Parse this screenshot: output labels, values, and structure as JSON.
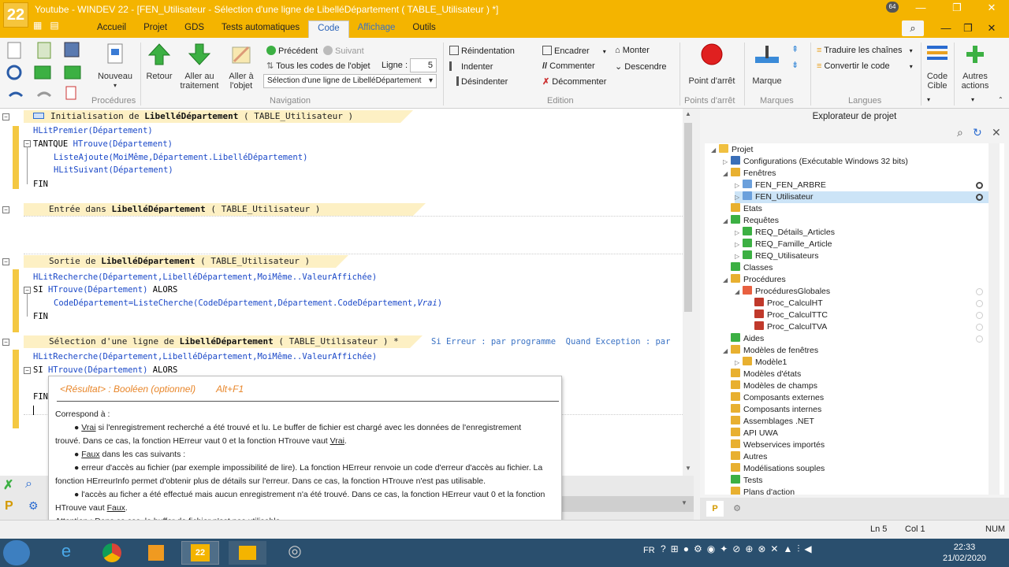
{
  "window": {
    "title": "Youtube - WINDEV 22 - [FEN_Utilisateur - Sélection d'une ligne de LibelléDépartement ( TABLE_Utilisateur ) *]",
    "badge": "64",
    "logo": "22"
  },
  "menu": [
    "Accueil",
    "Projet",
    "GDS",
    "Tests automatiques",
    "Code",
    "Affichage",
    "Outils"
  ],
  "ribbon": {
    "groups": [
      "Procédures",
      "Navigation",
      "Edition",
      "Points d'arrêt",
      "Marques",
      "Langues"
    ],
    "buttons": {
      "nouveau": "Nouveau",
      "retour": "Retour",
      "aller_traitement_1": "Aller au",
      "aller_traitement_2": "traitement",
      "aller_objet_1": "Aller à",
      "aller_objet_2": "l'objet",
      "precedent": "Précédent",
      "suivant": "Suivant",
      "tous_codes": "Tous les codes de l'objet",
      "ligne_label": "Ligne :",
      "ligne_value": "5",
      "selection_combo": "Sélection d'une ligne de LibelléDépartement",
      "reindentation": "Réindentation",
      "indenter": "Indenter",
      "desindenter": "Désindenter",
      "encadrer": "Encadrer",
      "commenter": "Commenter",
      "decommenter": "Décommenter",
      "monter": "Monter",
      "descendre": "Descendre",
      "point_arret": "Point d'arrêt",
      "marque": "Marque",
      "traduire": "Traduire les chaînes",
      "convertir": "Convertir le code",
      "code_cible_1": "Code",
      "code_cible_2": "Cible",
      "autres_1": "Autres",
      "autres_2": "actions"
    }
  },
  "editor": {
    "sections": [
      {
        "prefix": "Initialisation de ",
        "name": "LibelléDépartement",
        "suffix": " ( TABLE_Utilisateur )"
      },
      {
        "prefix": "Entrée dans ",
        "name": "LibelléDépartement",
        "suffix": " ( TABLE_Utilisateur )"
      },
      {
        "prefix": "Sortie de ",
        "name": "LibelléDépartement",
        "suffix": " ( TABLE_Utilisateur )"
      },
      {
        "prefix": "Sélection d'une ligne de ",
        "name": "LibelléDépartement",
        "suffix": " ( TABLE_Utilisateur ) *"
      }
    ],
    "error_info": "Si Erreur : par programme  Quand Exception : par",
    "code": {
      "l1": "HLitPremier(Département)",
      "l2_kw": "TANTQUE ",
      "l2": "HTrouve(Département)",
      "l3": "ListeAjoute(MoiMême,Département.LibelléDépartement)",
      "l4": "HLitSuivant(Département)",
      "fin": "FIN",
      "s3_l1": "HLitRecherche(Département,LibelléDépartement,MoiMême..ValeurAffichée)",
      "s3_l2_kw": "SI ",
      "s3_l2": "HTrouve(Département)",
      "alors": " ALORS",
      "s3_l3a": "CodeDépartement=ListeCherche(CodeDépartement,Département.CodeDépartement,",
      "s3_l3b": "Vrai",
      "s3_l3c": ")",
      "s4_l1": "HLitRecherche(Département,LibelléDépartement,MoiMême..ValeurAffichée)",
      "s4_l2_kw": "SI ",
      "s4_l2": "HTrouve(Département)",
      "s4_fin": "FIN"
    }
  },
  "tooltip": {
    "result": "<Résultat> : Booléen (optionnel)",
    "shortcut": "Alt+F1",
    "intro": "Correspond à :",
    "vrai_word": "Vrai",
    "vrai_text": " si l'enregistrement recherché a été trouvé et lu. Le buffer de fichier est chargé avec les données de l'enregistrement",
    "vrai_text2": "trouvé. Dans ce cas, la fonction HErreur vaut 0 et la fonction HTrouve vaut ",
    "vrai_word2": "Vrai",
    "faux_word": "Faux",
    "faux_text": " dans les cas suivants :",
    "err1": "erreur d'accès au fichier (par exemple impossibilité de lire). La fonction HErreur renvoie un code d'erreur d'accès au fichier. La",
    "err1b": "fonction HErreurInfo permet d'obtenir plus de détails sur l'erreur. Dans ce cas, la fonction HTrouve n'est pas utilisable.",
    "err2": "l'accès au ficher a été effectué mais aucun enregistrement n'a été trouvé. Dans ce cas, la fonction HErreur vaut 0 et la fonction",
    "err2b": "HTrouve vaut ",
    "faux_word2": "Faux",
    "attention": "Attention : Dans ce cas, le buffer de fichier n'est pas utilisable."
  },
  "explorer": {
    "title": "Explorateur de projet",
    "nodes": [
      {
        "label": "Projet",
        "level": 0
      },
      {
        "label": "Configurations (Exécutable Windows 32 bits)",
        "level": 1
      },
      {
        "label": "Fenêtres",
        "level": 1
      },
      {
        "label": "FEN_FEN_ARBRE",
        "level": 2
      },
      {
        "label": "FEN_Utilisateur",
        "level": 2
      },
      {
        "label": "Etats",
        "level": 1
      },
      {
        "label": "Requêtes",
        "level": 1
      },
      {
        "label": "REQ_Détails_Articles",
        "level": 2
      },
      {
        "label": "REQ_Famille_Article",
        "level": 2
      },
      {
        "label": "REQ_Utilisateurs",
        "level": 2
      },
      {
        "label": "Classes",
        "level": 1
      },
      {
        "label": "Procédures",
        "level": 1
      },
      {
        "label": "ProcéduresGlobales",
        "level": 2
      },
      {
        "label": "Proc_CalculHT",
        "level": 3
      },
      {
        "label": "Proc_CalculTTC",
        "level": 3
      },
      {
        "label": "Proc_CalculTVA",
        "level": 3
      },
      {
        "label": "Aides",
        "level": 1
      },
      {
        "label": "Modèles de fenêtres",
        "level": 1
      },
      {
        "label": "Modèle1",
        "level": 2
      },
      {
        "label": "Modèles d'états",
        "level": 1
      },
      {
        "label": "Modèles de champs",
        "level": 1
      },
      {
        "label": "Composants externes",
        "level": 1
      },
      {
        "label": "Composants internes",
        "level": 1
      },
      {
        "label": "Assemblages .NET",
        "level": 1
      },
      {
        "label": "API UWA",
        "level": 1
      },
      {
        "label": "Webservices importés",
        "level": 1
      },
      {
        "label": "Autres",
        "level": 1
      },
      {
        "label": "Modélisations souples",
        "level": 1
      },
      {
        "label": "Tests",
        "level": 1
      },
      {
        "label": "Plans d'action",
        "level": 1
      }
    ]
  },
  "status": {
    "line": "Ln 5",
    "col": "Col 1",
    "num": "NUM"
  },
  "taskbar": {
    "lang": "FR",
    "time": "22:33",
    "date": "21/02/2020"
  }
}
